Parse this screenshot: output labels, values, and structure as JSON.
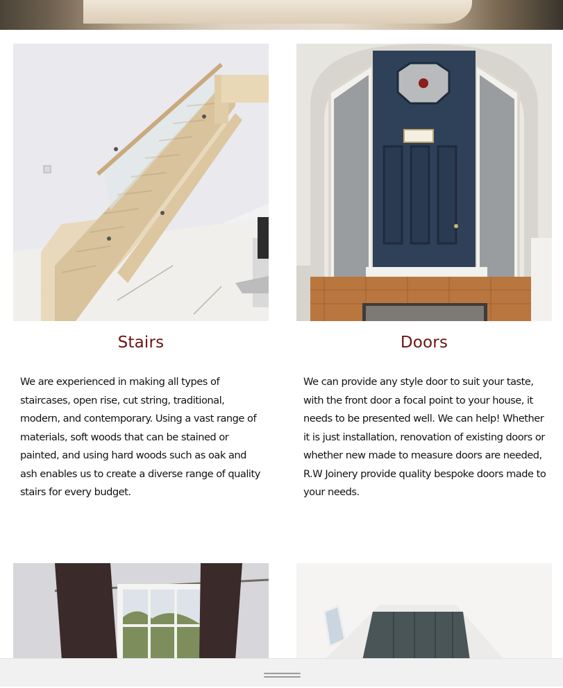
{
  "sections": [
    {
      "title": "Stairs",
      "description": "We are experienced in making all types of staircases, open rise, cut string, traditional, modern, and contemporary. Using a vast range of materials, soft woods that can be stained or painted, and using hard woods such as oak and ash enables us to create a diverse range of quality stairs for every budget."
    },
    {
      "title": "Doors",
      "description": "We can provide any style door to suit your taste, with the front door a focal point to your house, it needs to be presented well. We can help! Whether it is just installation, renovation of existing doors or whether new made to measure doors are needed, R.W Joinery provide quality bespoke doors made to your needs."
    }
  ],
  "colors": {
    "heading": "#6b1414",
    "door_blue": "#2f4159",
    "wardrobe_grey": "#4a5558"
  },
  "icons": {
    "footer_handle": "drag-handle-icon"
  }
}
